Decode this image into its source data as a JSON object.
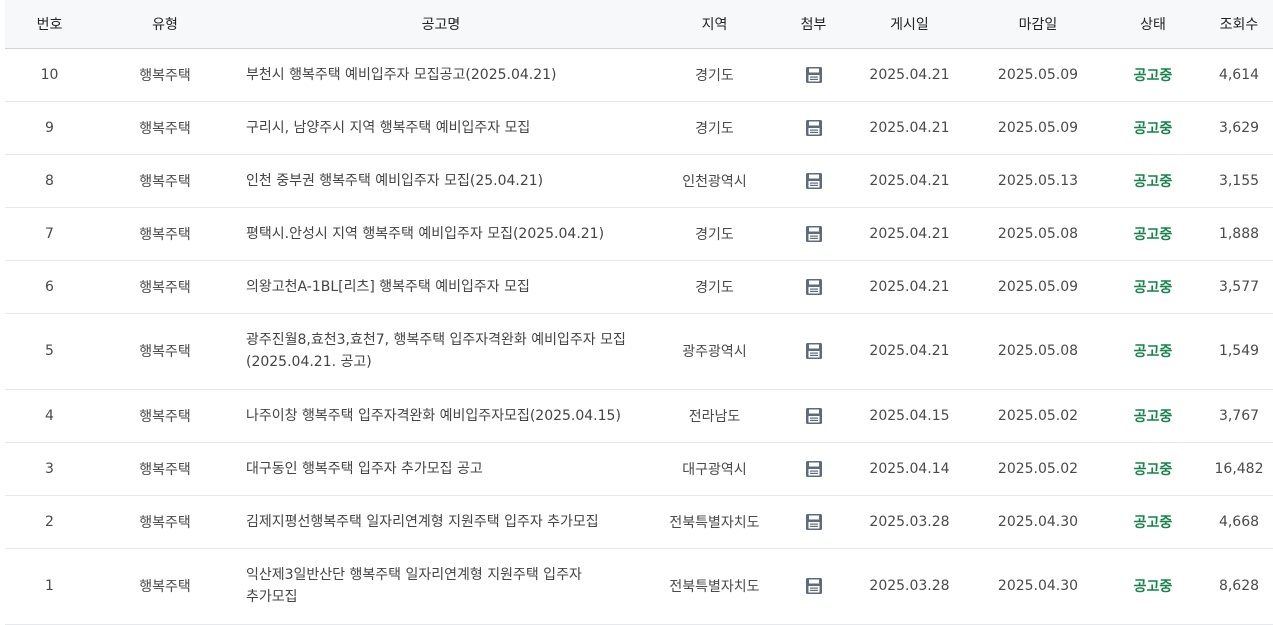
{
  "columns": {
    "no": "번호",
    "type": "유형",
    "title": "공고명",
    "region": "지역",
    "attach": "첨부",
    "posted": "게시일",
    "deadline": "마감일",
    "status": "상태",
    "views": "조회수"
  },
  "attachment_icon": "file-save-icon",
  "colors": {
    "status_open": "#16834a",
    "icon": "#5f6b7a",
    "header_bg": "#f7f8fa"
  },
  "rows": [
    {
      "no": "10",
      "type": "행복주택",
      "title_lines": [
        "부천시 행복주택 예비입주자 모집공고(2025.04.21)"
      ],
      "region": "경기도",
      "posted": "2025.04.21",
      "deadline": "2025.05.09",
      "status": "공고중",
      "views": "4,614"
    },
    {
      "no": "9",
      "type": "행복주택",
      "title_lines": [
        "구리시, 남양주시 지역 행복주택 예비입주자 모집"
      ],
      "region": "경기도",
      "posted": "2025.04.21",
      "deadline": "2025.05.09",
      "status": "공고중",
      "views": "3,629"
    },
    {
      "no": "8",
      "type": "행복주택",
      "title_lines": [
        "인천 중부권 행복주택 예비입주자 모집(25.04.21)"
      ],
      "region": "인천광역시",
      "posted": "2025.04.21",
      "deadline": "2025.05.13",
      "status": "공고중",
      "views": "3,155"
    },
    {
      "no": "7",
      "type": "행복주택",
      "title_lines": [
        "평택시.안성시 지역 행복주택 예비입주자 모집(2025.04.21)"
      ],
      "region": "경기도",
      "posted": "2025.04.21",
      "deadline": "2025.05.08",
      "status": "공고중",
      "views": "1,888"
    },
    {
      "no": "6",
      "type": "행복주택",
      "title_lines": [
        "의왕고천A-1BL[리츠] 행복주택 예비입주자 모집"
      ],
      "region": "경기도",
      "posted": "2025.04.21",
      "deadline": "2025.05.09",
      "status": "공고중",
      "views": "3,577"
    },
    {
      "no": "5",
      "type": "행복주택",
      "title_lines": [
        "광주진월8,효천3,효천7, 행복주택 입주자격완화 예비입주자 모집",
        "(2025.04.21. 공고)"
      ],
      "region": "광주광역시",
      "posted": "2025.04.21",
      "deadline": "2025.05.08",
      "status": "공고중",
      "views": "1,549"
    },
    {
      "no": "4",
      "type": "행복주택",
      "title_lines": [
        "나주이창 행복주택 입주자격완화 예비입주자모집(2025.04.15)"
      ],
      "region": "전라남도",
      "posted": "2025.04.15",
      "deadline": "2025.05.02",
      "status": "공고중",
      "views": "3,767"
    },
    {
      "no": "3",
      "type": "행복주택",
      "title_lines": [
        "대구동인 행복주택 입주자 추가모집 공고"
      ],
      "region": "대구광역시",
      "posted": "2025.04.14",
      "deadline": "2025.05.02",
      "status": "공고중",
      "views": "16,482"
    },
    {
      "no": "2",
      "type": "행복주택",
      "title_lines": [
        "김제지평선행복주택 일자리연계형 지원주택 입주자 추가모집"
      ],
      "region": "전북특별자치도",
      "posted": "2025.03.28",
      "deadline": "2025.04.30",
      "status": "공고중",
      "views": "4,668"
    },
    {
      "no": "1",
      "type": "행복주택",
      "title_lines": [
        "익산제3일반산단 행복주택 일자리연계형 지원주택 입주자",
        "추가모집"
      ],
      "region": "전북특별자치도",
      "posted": "2025.03.28",
      "deadline": "2025.04.30",
      "status": "공고중",
      "views": "8,628"
    }
  ]
}
